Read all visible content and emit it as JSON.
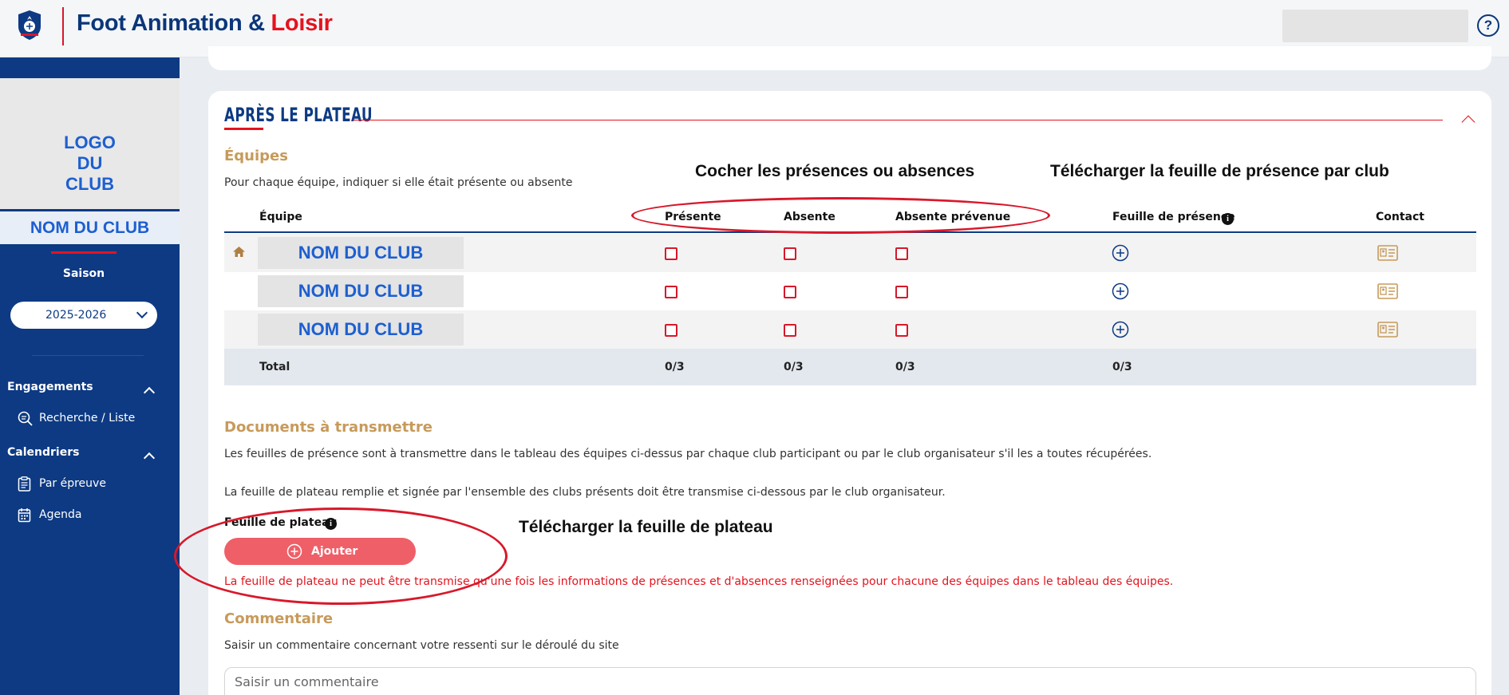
{
  "header": {
    "brand_main": "Foot Animation & ",
    "brand_accent": "Loisir",
    "help": "?",
    "brand_color": "#0b3679",
    "accent_color": "#e4131e"
  },
  "sidebar": {
    "logo_text": "LOGO\nDU\nCLUB",
    "club_name": "NOM DU CLUB",
    "season_label": "Saison",
    "season_value": "2025-2026",
    "sections": [
      {
        "label": "Engagements",
        "items": [
          {
            "label": "Recherche / Liste",
            "icon": "search-list-icon"
          }
        ]
      },
      {
        "label": "Calendriers",
        "items": [
          {
            "label": "Par épreuve",
            "icon": "clipboard-icon"
          },
          {
            "label": "Agenda",
            "icon": "calendar-icon"
          }
        ]
      }
    ]
  },
  "main": {
    "section_title": "APRÈS LE PLATEAU",
    "equipes": {
      "heading": "Équipes",
      "description": "Pour chaque équipe, indiquer si elle était présente ou absente",
      "annotation_presence": "Cocher les présences ou absences",
      "annotation_download": "Télécharger la feuille de présence par club",
      "columns": {
        "equipe": "Équipe",
        "presente": "Présente",
        "absente": "Absente",
        "absente_prevenue": "Absente prévenue",
        "feuille": "Feuille de présence",
        "contact": "Contact"
      },
      "rows": [
        {
          "club": "NOM DU CLUB",
          "home": true
        },
        {
          "club": "NOM DU CLUB",
          "home": false
        },
        {
          "club": "NOM DU CLUB",
          "home": false
        }
      ],
      "total": {
        "label": "Total",
        "presente": "0/3",
        "absente": "0/3",
        "absente_prevenue": "0/3",
        "feuille": "0/3"
      }
    },
    "documents": {
      "heading": "Documents à transmettre",
      "text1": "Les feuilles de présence sont à transmettre dans le tableau des équipes ci-dessus par chaque club participant ou par le club organisateur s'il les a toutes récupérées.",
      "text2": "La feuille de plateau remplie et signée par l'ensemble des clubs présents doit être transmise ci-dessous par le club organisateur.",
      "feuille_label": "Feuille de plateau",
      "annotation_plateau": "Télécharger la feuille de plateau",
      "add_button": "Ajouter",
      "warning": "La feuille de plateau ne peut être transmise qu'une fois les informations de présences et d'absences renseignées pour chacune des équipes dans le tableau des équipes."
    },
    "commentaire": {
      "heading": "Commentaire",
      "description": "Saisir un commentaire concernant votre ressenti sur le déroulé du site",
      "placeholder": "Saisir un commentaire"
    }
  }
}
